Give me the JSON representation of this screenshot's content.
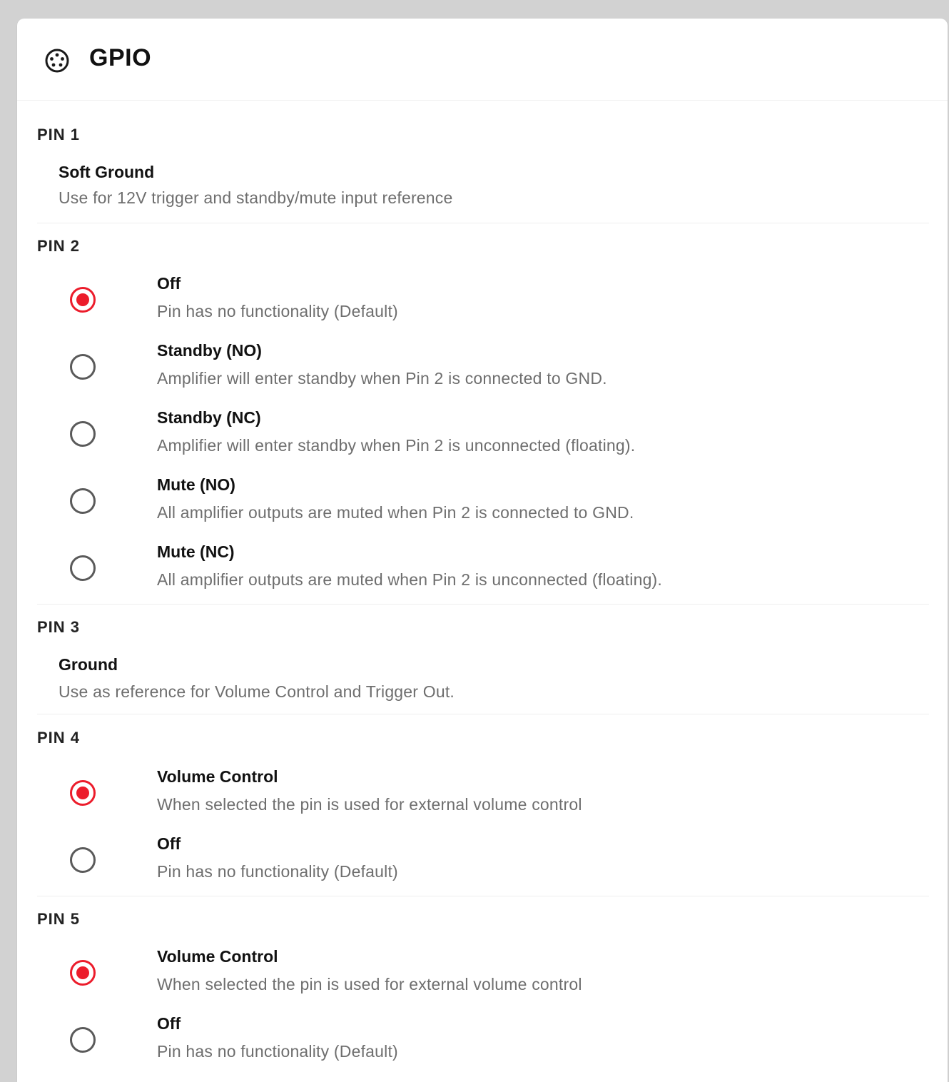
{
  "card": {
    "title": "GPIO",
    "icon": "connector-pin-icon"
  },
  "accent_color": "#ec1c2b",
  "pins": [
    {
      "label": "PIN 1",
      "static": {
        "title": "Soft Ground",
        "description": "Use for 12V trigger and standby/mute input reference"
      }
    },
    {
      "label": "PIN 2",
      "options": [
        {
          "title": "Off",
          "description": "Pin has no functionality (Default)",
          "selected": true
        },
        {
          "title": "Standby (NO)",
          "description": "Amplifier will enter standby when Pin 2 is connected to GND.",
          "selected": false
        },
        {
          "title": "Standby (NC)",
          "description": "Amplifier will enter standby when Pin 2 is unconnected (floating).",
          "selected": false
        },
        {
          "title": "Mute (NO)",
          "description": "All amplifier outputs are muted when Pin 2 is connected to GND.",
          "selected": false
        },
        {
          "title": "Mute (NC)",
          "description": "All amplifier outputs are muted when Pin 2 is unconnected (floating).",
          "selected": false
        }
      ]
    },
    {
      "label": "PIN 3",
      "static": {
        "title": "Ground",
        "description": "Use as reference for Volume Control and Trigger Out."
      }
    },
    {
      "label": "PIN 4",
      "options": [
        {
          "title": "Volume Control",
          "description": "When selected the pin is used for external volume control",
          "selected": true
        },
        {
          "title": "Off",
          "description": "Pin has no functionality (Default)",
          "selected": false
        }
      ]
    },
    {
      "label": "PIN 5",
      "options": [
        {
          "title": "Volume Control",
          "description": "When selected the pin is used for external volume control",
          "selected": true
        },
        {
          "title": "Off",
          "description": "Pin has no functionality (Default)",
          "selected": false
        }
      ]
    }
  ]
}
